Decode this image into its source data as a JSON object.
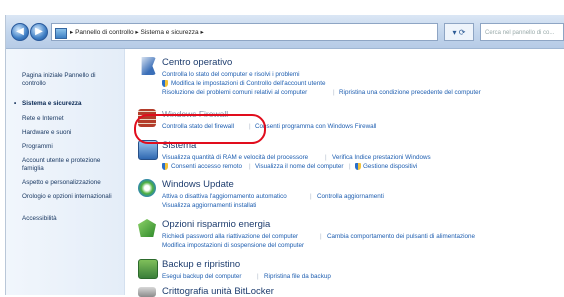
{
  "address": {
    "path": "▸ Pannello di controllo ▸ Sistema e sicurezza ▸",
    "search_placeholder": "Cerca nel pannello di co..."
  },
  "sidebar": {
    "items": [
      "Pagina iniziale Pannello di controllo",
      "Sistema e sicurezza",
      "Rete e Internet",
      "Hardware e suoni",
      "Programmi",
      "Account utente e protezione famiglia",
      "Aspetto e personalizzazione",
      "Orologio e opzioni internazionali",
      "Accessibilità"
    ]
  },
  "categories": {
    "centro": {
      "title": "Centro operativo",
      "l1": "Controlla lo stato del computer e risolvi i problemi",
      "l2": "Modifica le impostazioni di Controllo dell'account utente",
      "l3a": "Risoluzione dei problemi comuni relativi al computer",
      "l3b": "Ripristina una condizione precedente del computer"
    },
    "firewall": {
      "title": "Windows Firewall",
      "l1a": "Controlla stato del firewall",
      "l1b": "Consenti programma con Windows Firewall"
    },
    "sistema": {
      "title": "Sistema",
      "l1a": "Visualizza quantità di RAM e velocità del processore",
      "l1b": "Verifica Indice prestazioni Windows",
      "l2a": "Consenti accesso remoto",
      "l2b": "Visualizza il nome del computer",
      "l2c": "Gestione dispositivi"
    },
    "update": {
      "title": "Windows Update",
      "l1a": "Attiva o disattiva l'aggiornamento automatico",
      "l1b": "Controlla aggiornamenti",
      "l2": "Visualizza aggiornamenti installati"
    },
    "energia": {
      "title": "Opzioni risparmio energia",
      "l1a": "Richiedi password alla riattivazione del computer",
      "l1b": "Cambia comportamento dei pulsanti di alimentazione",
      "l2": "Modifica impostazioni di sospensione del computer"
    },
    "backup": {
      "title": "Backup e ripristino",
      "l1a": "Esegui backup del computer",
      "l1b": "Ripristina file da backup"
    },
    "bitlocker": {
      "title": "Crittografia unità BitLocker"
    }
  },
  "colors": {
    "link": "#1e5eb0",
    "title": "#1e3d6e",
    "highlight": "#e10d1d"
  }
}
